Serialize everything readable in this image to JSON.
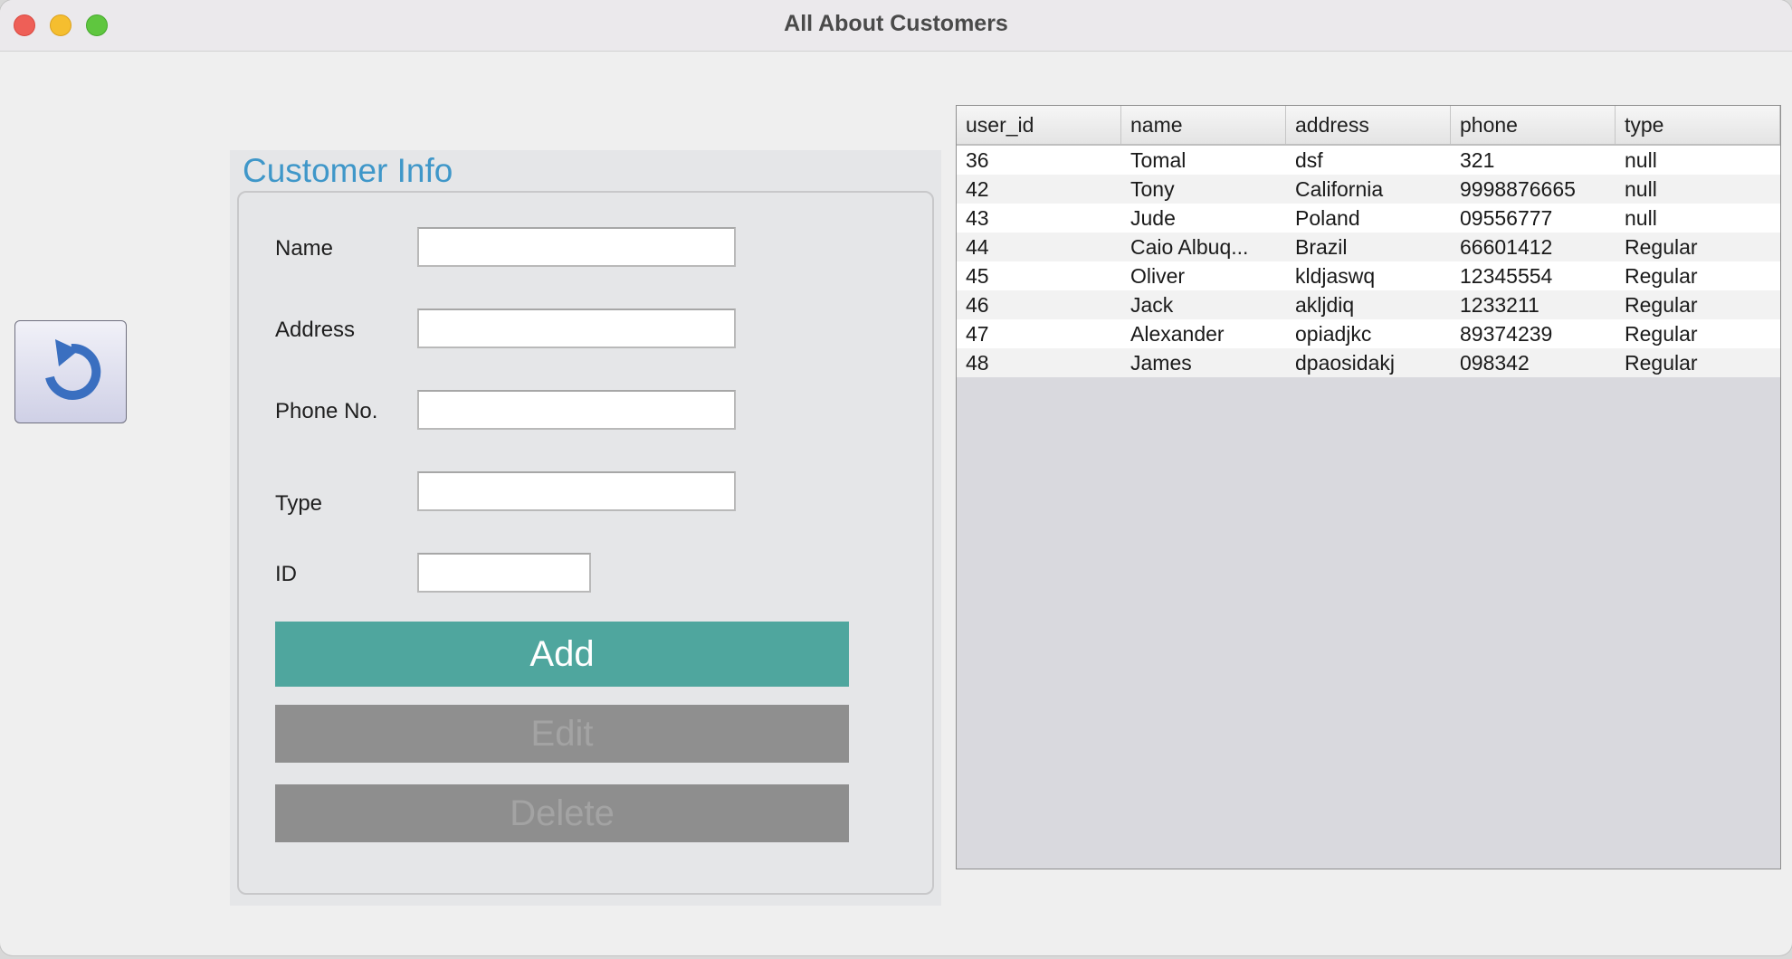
{
  "window": {
    "title": "All About Customers"
  },
  "back_button": {
    "icon": "undo-arrow-icon"
  },
  "form": {
    "panel_title": "Customer Info",
    "labels": {
      "name": "Name",
      "address": "Address",
      "phone": "Phone No.",
      "type": "Type",
      "id": "ID"
    },
    "values": {
      "name": "",
      "address": "",
      "phone": "",
      "type": "",
      "id": ""
    },
    "buttons": {
      "add": "Add",
      "edit": "Edit",
      "delete": "Delete"
    }
  },
  "table": {
    "columns": [
      "user_id",
      "name",
      "address",
      "phone",
      "type"
    ],
    "rows": [
      [
        "36",
        "Tomal",
        "dsf",
        "321",
        "null"
      ],
      [
        "42",
        "Tony",
        "California",
        "9998876665",
        "null"
      ],
      [
        "43",
        "Jude",
        "Poland",
        "09556777",
        "null"
      ],
      [
        "44",
        "Caio Albuq...",
        "Brazil",
        "66601412",
        "Regular"
      ],
      [
        "45",
        "Oliver",
        "kldjaswq",
        "12345554",
        "Regular"
      ],
      [
        "46",
        "Jack",
        "akljdiq",
        "1233211",
        "Regular"
      ],
      [
        "47",
        "Alexander",
        "opiadjkc",
        "89374239",
        "Regular"
      ],
      [
        "48",
        "James",
        "dpaosidakj",
        "098342",
        "Regular"
      ]
    ]
  },
  "colors": {
    "accent_title": "#3f97c9",
    "add_button": "#4fa69e",
    "disabled_button": "#8f8f8f"
  }
}
